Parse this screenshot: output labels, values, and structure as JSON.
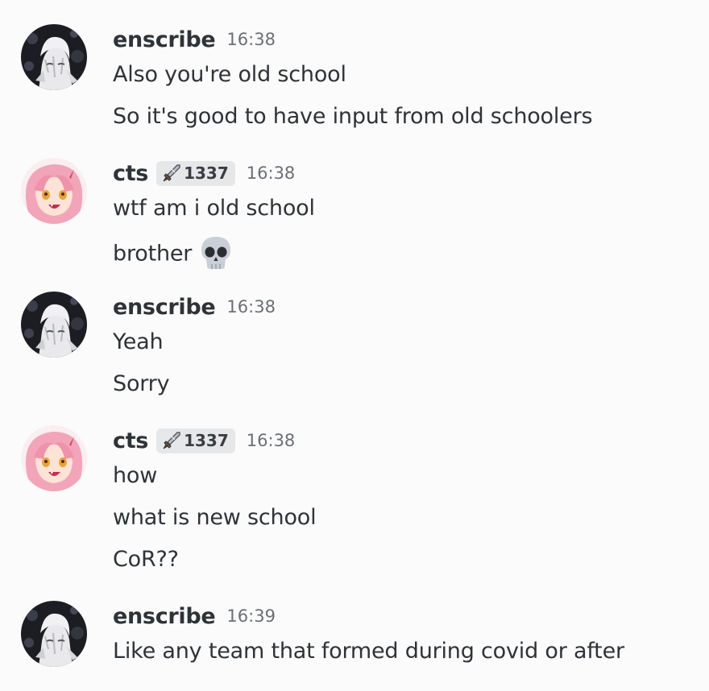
{
  "messages": [
    {
      "author": "enscribe",
      "time": "16:38",
      "avatar_icon": "enscribe-avatar",
      "lines": [
        "Also you're old school",
        "So it's good to have input from old schoolers"
      ]
    },
    {
      "author": "cts",
      "tag": "1337",
      "tag_icon": "sword-icon",
      "time": "16:38",
      "avatar_icon": "cts-avatar",
      "lines": [
        "wtf am i old school",
        "brother"
      ],
      "emoji": "skull-emoji"
    },
    {
      "author": "enscribe",
      "time": "16:38",
      "avatar_icon": "enscribe-avatar",
      "lines": [
        "Yeah",
        "Sorry"
      ]
    },
    {
      "author": "cts",
      "tag": "1337",
      "tag_icon": "sword-icon",
      "time": "16:38",
      "avatar_icon": "cts-avatar",
      "lines": [
        "how",
        "what is new school",
        "CoR??"
      ]
    },
    {
      "author": "enscribe",
      "time": "16:39",
      "avatar_icon": "enscribe-avatar",
      "lines": [
        "Like any team that formed during covid or after"
      ]
    }
  ],
  "colors": {
    "background": "#fbfbfb",
    "text": "#2e3338",
    "timestamp": "#6b6f76",
    "tag_bg": "#e6e7e9",
    "cts_hair": "#f2a5b8",
    "enscribe_dark": "#1c1d22"
  }
}
